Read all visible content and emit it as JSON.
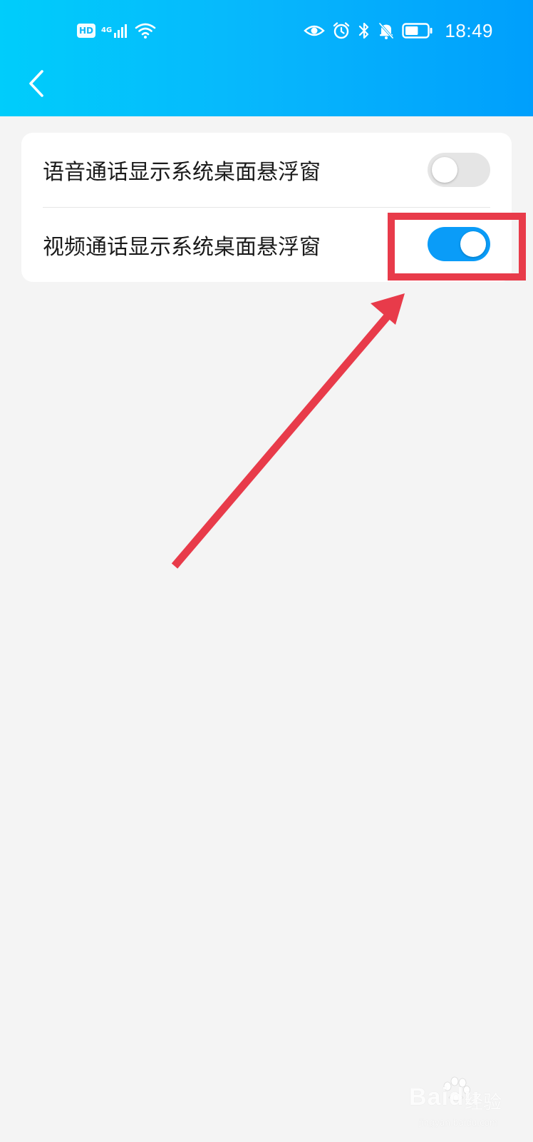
{
  "status_bar": {
    "hd_label": "HD",
    "network_type": "4G",
    "time": "18:49",
    "icons": [
      "hd-icon",
      "signal-icon",
      "wifi-icon",
      "eye-icon",
      "alarm-icon",
      "bluetooth-icon",
      "mute-bell-icon",
      "battery-icon"
    ],
    "battery_level": 0.6
  },
  "header": {
    "back_icon": "chevron-left-icon",
    "gradient": [
      "#00cdfb",
      "#009ffc"
    ]
  },
  "settings": {
    "items": [
      {
        "label": "语音通话显示系统桌面悬浮窗",
        "enabled": false
      },
      {
        "label": "视频通话显示系统桌面悬浮窗",
        "enabled": true
      }
    ]
  },
  "annotation": {
    "color": "#e83b4a",
    "highlight_target": "video-call-toggle"
  },
  "watermark": {
    "brand": "Baidu",
    "name": "经验",
    "url": "jingyan.baidu.com"
  },
  "colors": {
    "toggle_on": "#0a9cf8",
    "toggle_off": "#e5e5e5",
    "background": "#f4f4f4"
  }
}
